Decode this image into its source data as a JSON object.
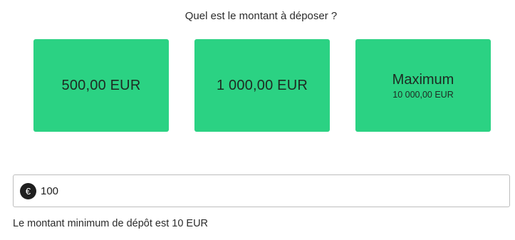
{
  "question": "Quel est le montant à déposer ?",
  "options": [
    {
      "label": "500,00 EUR"
    },
    {
      "label": "1 000,00 EUR"
    },
    {
      "title": "Maximum",
      "subtitle": "10 000,00 EUR"
    }
  ],
  "amount_field": {
    "currency_icon": "euro-icon",
    "currency_symbol": "€",
    "value": "100"
  },
  "hint": "Le montant minimum de dépôt est 10 EUR",
  "colors": {
    "option_background": "#2bd283",
    "text": "#1f1f1f"
  }
}
